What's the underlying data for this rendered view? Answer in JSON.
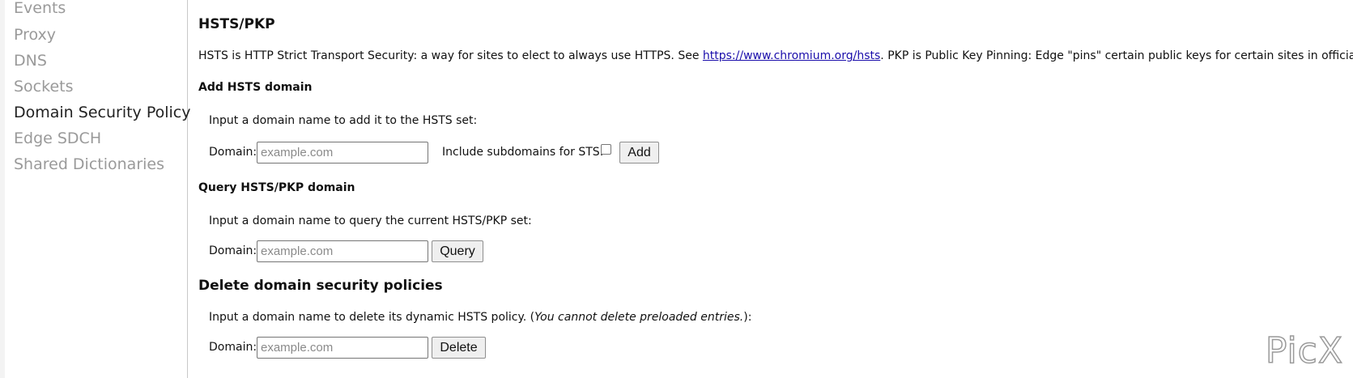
{
  "sidebar": {
    "items": [
      {
        "label": "Events"
      },
      {
        "label": "Proxy"
      },
      {
        "label": "DNS"
      },
      {
        "label": "Sockets"
      },
      {
        "label": "Domain Security Policy",
        "active": true
      },
      {
        "label": "Edge SDCH"
      },
      {
        "label": "Shared Dictionaries"
      }
    ]
  },
  "main": {
    "title": "HSTS/PKP",
    "description": {
      "before_link": "HSTS is HTTP Strict Transport Security: a way for sites to elect to always use HTTPS. See ",
      "link_text": "https://www.chromium.org/hsts",
      "after_link": ". PKP is Public Key Pinning: Edge \"pins\" certain public keys for certain sites in official builds."
    },
    "add_section": {
      "heading": "Add HSTS domain",
      "instruction": "Input a domain name to add it to the HSTS set:",
      "domain_label": "Domain:",
      "domain_placeholder": "example.com",
      "subdomains_label": "Include subdomains for STS:",
      "subdomains_checked": false,
      "button_label": "Add"
    },
    "query_section": {
      "heading": "Query HSTS/PKP domain",
      "instruction": "Input a domain name to query the current HSTS/PKP set:",
      "domain_label": "Domain:",
      "domain_placeholder": "example.com",
      "button_label": "Query"
    },
    "delete_section": {
      "heading": "Delete domain security policies",
      "instruction_before": "Input a domain name to delete its dynamic HSTS policy. (",
      "instruction_italic": "You cannot delete preloaded entries.",
      "instruction_after": "):",
      "domain_label": "Domain:",
      "domain_placeholder": "example.com",
      "button_label": "Delete"
    }
  },
  "watermark": "PicX"
}
